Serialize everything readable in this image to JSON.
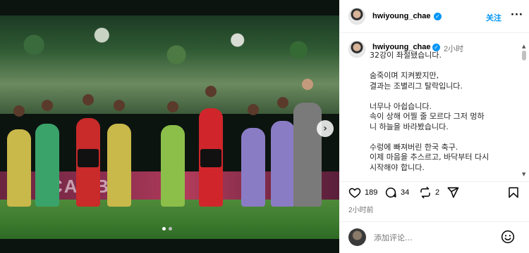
{
  "photo": {
    "board_text": "CAMBIA",
    "carousel_dots": 2,
    "active_dot": 1
  },
  "header": {
    "username": "hwiyoung_chae",
    "follow_label": "关注",
    "more_label": "···"
  },
  "caption": {
    "username": "hwiyoung_chae",
    "time": "2小时",
    "lines": [
      "32강이 좌절됐습니다.",
      "",
      "숨죽이며 지켜봤지만,",
      "결과는 조별리그 탈락입니다.",
      "",
      "너무나 아쉽습니다.",
      "속이 상해 어찔 줄 모르다 그저 멍하",
      "니 하늘을 바라봤습니다.",
      "",
      "수렁에 빠져버린 한국 축구.",
      "이제 마음을 추스르고, 바닥부터 다시",
      "시작해야 합니다."
    ]
  },
  "actions": {
    "likes": "189",
    "comments": "34",
    "reposts": "2"
  },
  "post_time": "2小时前",
  "comment_box": {
    "placeholder": "添加评论..."
  },
  "colors": {
    "accent": "#0095f6",
    "muted": "#737373"
  },
  "icons": [
    "heart-icon",
    "comment-icon",
    "repost-icon",
    "share-icon",
    "bookmark-icon",
    "emoji-icon",
    "verified-badge-icon",
    "chevron-right-icon"
  ]
}
